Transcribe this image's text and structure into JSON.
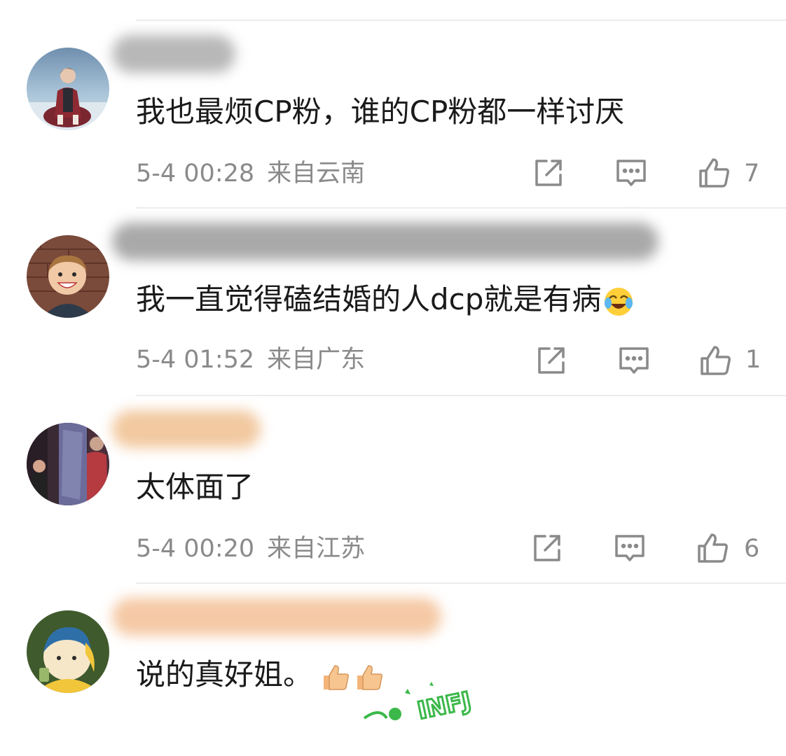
{
  "comments": [
    {
      "text": "我也最烦CP粉，谁的CP粉都一样讨厌",
      "time": "5-4 00:28",
      "location": "来自云南",
      "likes": "7"
    },
    {
      "text": "我一直觉得磕结婚的人dcp就是有病",
      "time": "5-4 01:52",
      "location": "来自广东",
      "likes": "1"
    },
    {
      "text": "太体面了",
      "time": "5-4 00:20",
      "location": "来自江苏",
      "likes": "6"
    },
    {
      "text": "说的真好姐。",
      "time": "",
      "location": "",
      "likes": ""
    }
  ],
  "sticker": {
    "label": "INFJ"
  },
  "icons": {
    "share": "share-icon",
    "reply": "comment-icon",
    "like": "thumbs-up-icon"
  },
  "colors": {
    "text": "#1a1a1a",
    "meta": "#8a8a8a",
    "divider": "#ececec",
    "sticker_green": "#3cb84a"
  }
}
